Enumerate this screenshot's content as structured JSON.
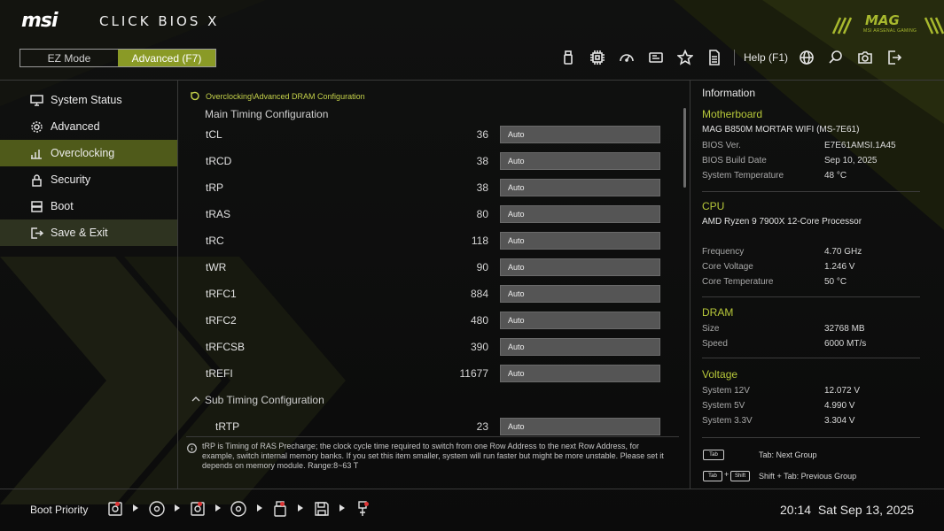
{
  "header": {
    "brand": "msi",
    "product": "CLICK BIOS X",
    "mode_ez": "EZ Mode",
    "mode_advanced": "Advanced (F7)",
    "help": "Help (F1)",
    "mag_logo": "MAG",
    "mag_sub": "MSI ARSENAL GAMING",
    "accent": "#8a9a26",
    "toolbar_icons": [
      "usb-icon",
      "cpu-icon",
      "gauge-icon",
      "bios-chip-icon",
      "favorite-star-icon",
      "document-icon",
      "globe-icon",
      "search-icon",
      "camera-icon",
      "exit-icon"
    ]
  },
  "sidebar": {
    "items": [
      {
        "label": "System Status",
        "icon": "monitor-icon"
      },
      {
        "label": "Advanced",
        "icon": "gear-icon"
      },
      {
        "label": "Overclocking",
        "icon": "chart-icon"
      },
      {
        "label": "Security",
        "icon": "lock-icon"
      },
      {
        "label": "Boot",
        "icon": "boot-icon"
      },
      {
        "label": "Save & Exit",
        "icon": "exit-icon"
      }
    ]
  },
  "main": {
    "breadcrumb": "Overclocking\\Advanced DRAM Configuration",
    "main_timing": "Main Timing Configuration",
    "sub_timing": "Sub Timing Configuration",
    "rows": [
      {
        "name": "tCL",
        "value": "36",
        "setting": "Auto"
      },
      {
        "name": "tRCD",
        "value": "38",
        "setting": "Auto"
      },
      {
        "name": "tRP",
        "value": "38",
        "setting": "Auto"
      },
      {
        "name": "tRAS",
        "value": "80",
        "setting": "Auto"
      },
      {
        "name": "tRC",
        "value": "118",
        "setting": "Auto"
      },
      {
        "name": "tWR",
        "value": "90",
        "setting": "Auto"
      },
      {
        "name": "tRFC1",
        "value": "884",
        "setting": "Auto"
      },
      {
        "name": "tRFC2",
        "value": "480",
        "setting": "Auto"
      },
      {
        "name": "tRFCSB",
        "value": "390",
        "setting": "Auto"
      },
      {
        "name": "tREFI",
        "value": "11677",
        "setting": "Auto"
      }
    ],
    "sub_rows": [
      {
        "name": "tRTP",
        "value": "23",
        "setting": "Auto"
      }
    ],
    "help_text": "tRP is Timing of RAS Precharge; the clock cycle time required to switch from one Row Address to the next Row Address, for example, switch internal memory banks. If you set this item smaller, system will run faster but might be more unstable. Please set it depends on memory module. Range:8~63 T"
  },
  "info": {
    "title": "Information",
    "motherboard_head": "Motherboard",
    "motherboard": "MAG B850M MORTAR WIFI (MS-7E61)",
    "bios_ver_l": "BIOS Ver.",
    "bios_ver": "E7E61AMSI.1A45",
    "bios_date_l": "BIOS Build Date",
    "bios_date": "Sep 10, 2025",
    "sys_temp_l": "System Temperature",
    "sys_temp": "48 °C",
    "cpu_head": "CPU",
    "cpu": "AMD Ryzen 9 7900X 12-Core Processor",
    "freq_l": "Frequency",
    "freq": "4.70 GHz",
    "cvolt_l": "Core Voltage",
    "cvolt": "1.246 V",
    "ctemp_l": "Core Temperature",
    "ctemp": "50 °C",
    "dram_head": "DRAM",
    "size_l": "Size",
    "size": "32768 MB",
    "speed_l": "Speed",
    "speed": "6000 MT/s",
    "volt_head": "Voltage",
    "v12_l": "System 12V",
    "v12": "12.072 V",
    "v5_l": "System 5V",
    "v5": "4.990 V",
    "v33_l": "System 3.3V",
    "v33": "3.304 V",
    "key_tab": "Tab",
    "key_shift": "Shift",
    "tab_hint": "Tab: Next Group",
    "shift_tab_hint": "Shift + Tab: Previous Group"
  },
  "footer": {
    "boot_priority": "Boot Priority",
    "boot_devices": [
      "hdd-icon",
      "optical-disc-icon",
      "hdd-icon",
      "optical-disc-icon",
      "usb-drive-icon",
      "floppy-icon",
      "usb-key-icon"
    ],
    "time": "20:14",
    "date": "Sat Sep 13, 2025"
  }
}
